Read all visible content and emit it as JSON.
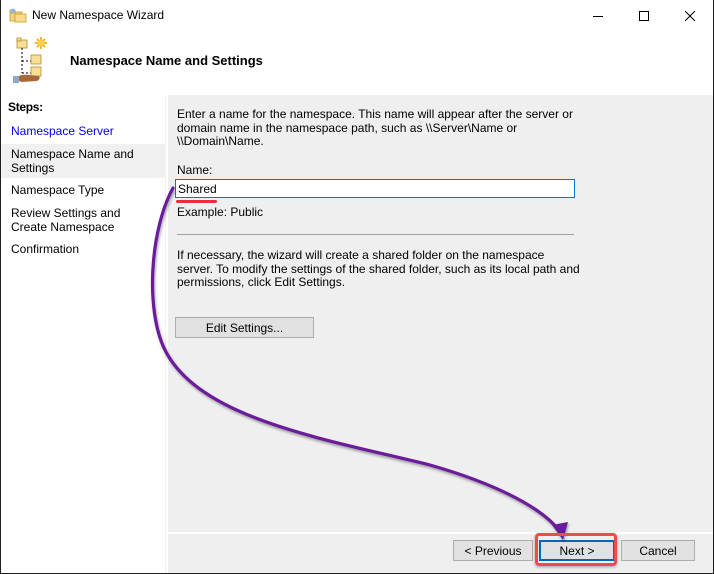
{
  "window": {
    "title": "New Namespace Wizard",
    "controls": {
      "minimize": "minimize",
      "maximize": "maximize",
      "close": "close"
    }
  },
  "header": {
    "title": "Namespace Name and Settings"
  },
  "sidebar": {
    "heading": "Steps:",
    "steps": [
      {
        "label": "Namespace Server",
        "state": "completed-link"
      },
      {
        "label": "Namespace Name and Settings",
        "state": "current"
      },
      {
        "label": "Namespace Type",
        "state": "pending"
      },
      {
        "label": "Review Settings and Create Namespace",
        "state": "pending"
      },
      {
        "label": "Confirmation",
        "state": "pending"
      }
    ]
  },
  "main": {
    "description": "Enter a name for the namespace. This name will appear after the server or domain name in the namespace path, such as \\\\Server\\Name or \\\\Domain\\Name.",
    "name_label": "Name:",
    "name_value": "Shared",
    "example": "Example: Public",
    "shared_folder_note": "If necessary, the wizard will create a shared folder on the namespace server. To modify the settings of the shared folder, such as its local path and permissions, click Edit Settings.",
    "edit_settings_label": "Edit Settings..."
  },
  "footer": {
    "previous_label": "< Previous",
    "next_label": "Next >",
    "cancel_label": "Cancel"
  },
  "annotations": {
    "arrow_color": "#6a1b9a",
    "highlight_color": "#f04a4a",
    "underline_color": "#e8303a",
    "arrow_from": "name-input",
    "arrow_to": "next-button"
  }
}
